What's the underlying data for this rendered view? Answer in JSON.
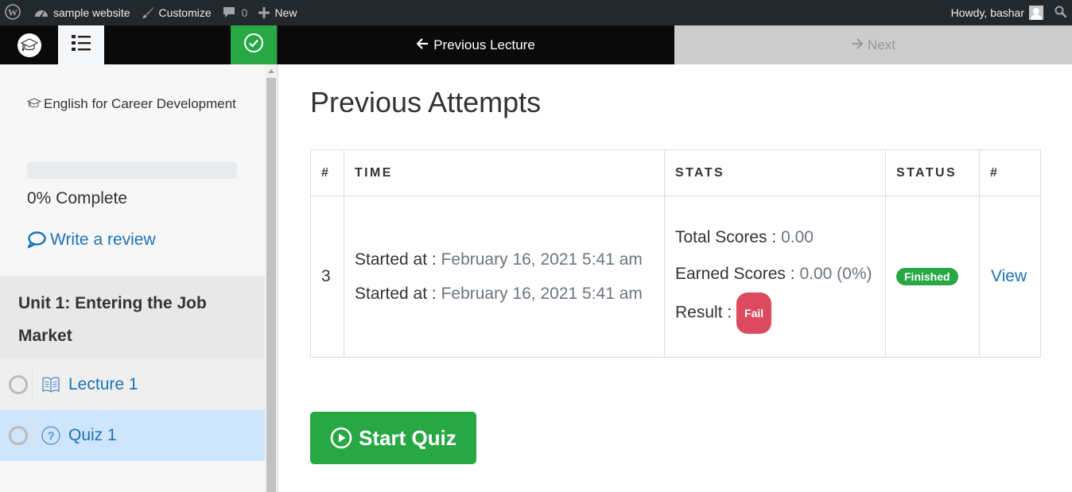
{
  "admin_bar": {
    "site_name": "sample website",
    "customize": "Customize",
    "comments_count": "0",
    "new": "New",
    "greeting": "Howdy, bashar",
    "icons": [
      "wordpress-icon",
      "dashboard-icon",
      "brush-icon",
      "comment-icon",
      "plus-icon",
      "avatar",
      "search-icon"
    ]
  },
  "topnav": {
    "prev_label": "Previous Lecture",
    "next_label": "Next",
    "icons": [
      "graduation-cap-icon",
      "list-icon",
      "check-circle-icon",
      "arrow-left-icon",
      "arrow-right-icon"
    ]
  },
  "sidebar": {
    "course_title": "English for Career Development",
    "progress_percent": 0,
    "complete_label": "0% Complete",
    "review_label": "Write a review",
    "unit_title": "Unit 1: Entering the Job Market",
    "items": [
      {
        "label": "Lecture 1",
        "type": "lecture",
        "icon": "book-icon",
        "active": false
      },
      {
        "label": "Quiz 1",
        "type": "quiz",
        "icon": "question-circle-icon",
        "active": true
      }
    ]
  },
  "main": {
    "title": "Previous Attempts",
    "table": {
      "headers": [
        "#",
        "TIME",
        "STATS",
        "STATUS",
        "#"
      ],
      "rows": [
        {
          "num": "3",
          "time_lines": [
            {
              "label": "Started at :",
              "value": "February 16, 2021 5:41 am"
            },
            {
              "label": "Started at :",
              "value": "February 16, 2021 5:41 am"
            }
          ],
          "stats": {
            "total_label": "Total Scores :",
            "total_value": "0.00",
            "earned_label": "Earned Scores :",
            "earned_value": "0.00 (0%)",
            "result_label": "Result :",
            "result_value": "Fail"
          },
          "status": "Finished",
          "action": "View"
        }
      ]
    },
    "start_button": "Start Quiz"
  },
  "colors": {
    "success": "#28a745",
    "danger": "#dc4a5f",
    "link": "#1a73b8",
    "admin_bar": "#23282d",
    "active_item": "#cfe5fc"
  }
}
